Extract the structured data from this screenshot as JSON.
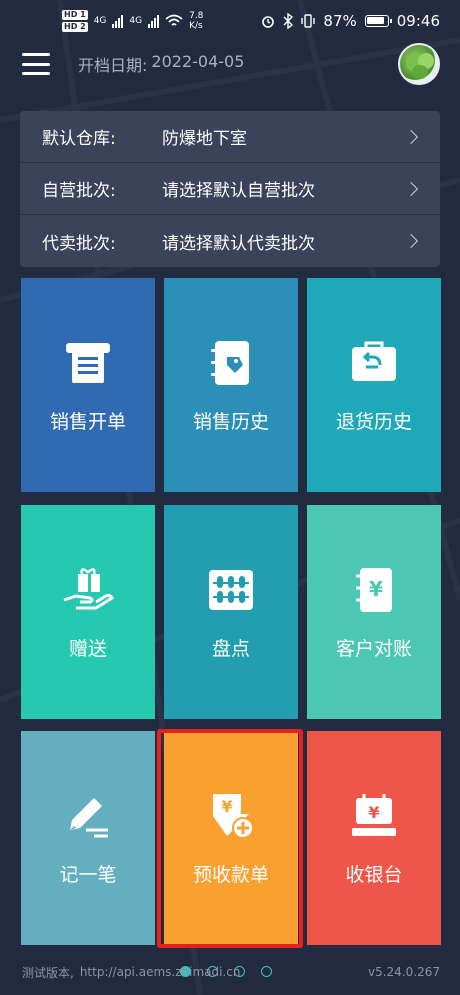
{
  "status_bar": {
    "hd1": "HD 1",
    "hd2": "HD 2",
    "net1": "4G",
    "net2": "4G",
    "speed_value": "7.8",
    "speed_unit": "K/s",
    "battery": "87%",
    "time": "09:46"
  },
  "header": {
    "date_label": "开档日期:",
    "date_value": "2022-04-05"
  },
  "settings": [
    {
      "label": "默认仓库:",
      "value": "防爆地下室"
    },
    {
      "label": "自营批次:",
      "value": "请选择默认自营批次"
    },
    {
      "label": "代卖批次:",
      "value": "请选择默认代卖批次"
    }
  ],
  "tiles": [
    {
      "label": "销售开单",
      "icon": "printer-receipt-icon",
      "color": "#2f6ab3"
    },
    {
      "label": "销售历史",
      "icon": "notebook-tag-icon",
      "color": "#2b8fb8"
    },
    {
      "label": "退货历史",
      "icon": "return-bag-icon",
      "color": "#1fa9b8"
    },
    {
      "label": "赠送",
      "icon": "gift-hand-icon",
      "color": "#26c9b0"
    },
    {
      "label": "盘点",
      "icon": "abacus-icon",
      "color": "#239eb0"
    },
    {
      "label": "客户对账",
      "icon": "yuan-notebook-icon",
      "color": "#4cc7b3"
    },
    {
      "label": "记一笔",
      "icon": "pencil-note-icon",
      "color": "#63afbf"
    },
    {
      "label": "预收款单",
      "icon": "yuan-receipt-plus-icon",
      "color": "#f9a030"
    },
    {
      "label": "收银台",
      "icon": "cash-register-icon",
      "color": "#ee5649"
    }
  ],
  "footer": {
    "test_label": "测试版本,",
    "url": "http://api.aems.zhimadi.cn",
    "version": "v5.24.0.267"
  },
  "pager": {
    "pages": 4,
    "active": 0
  }
}
